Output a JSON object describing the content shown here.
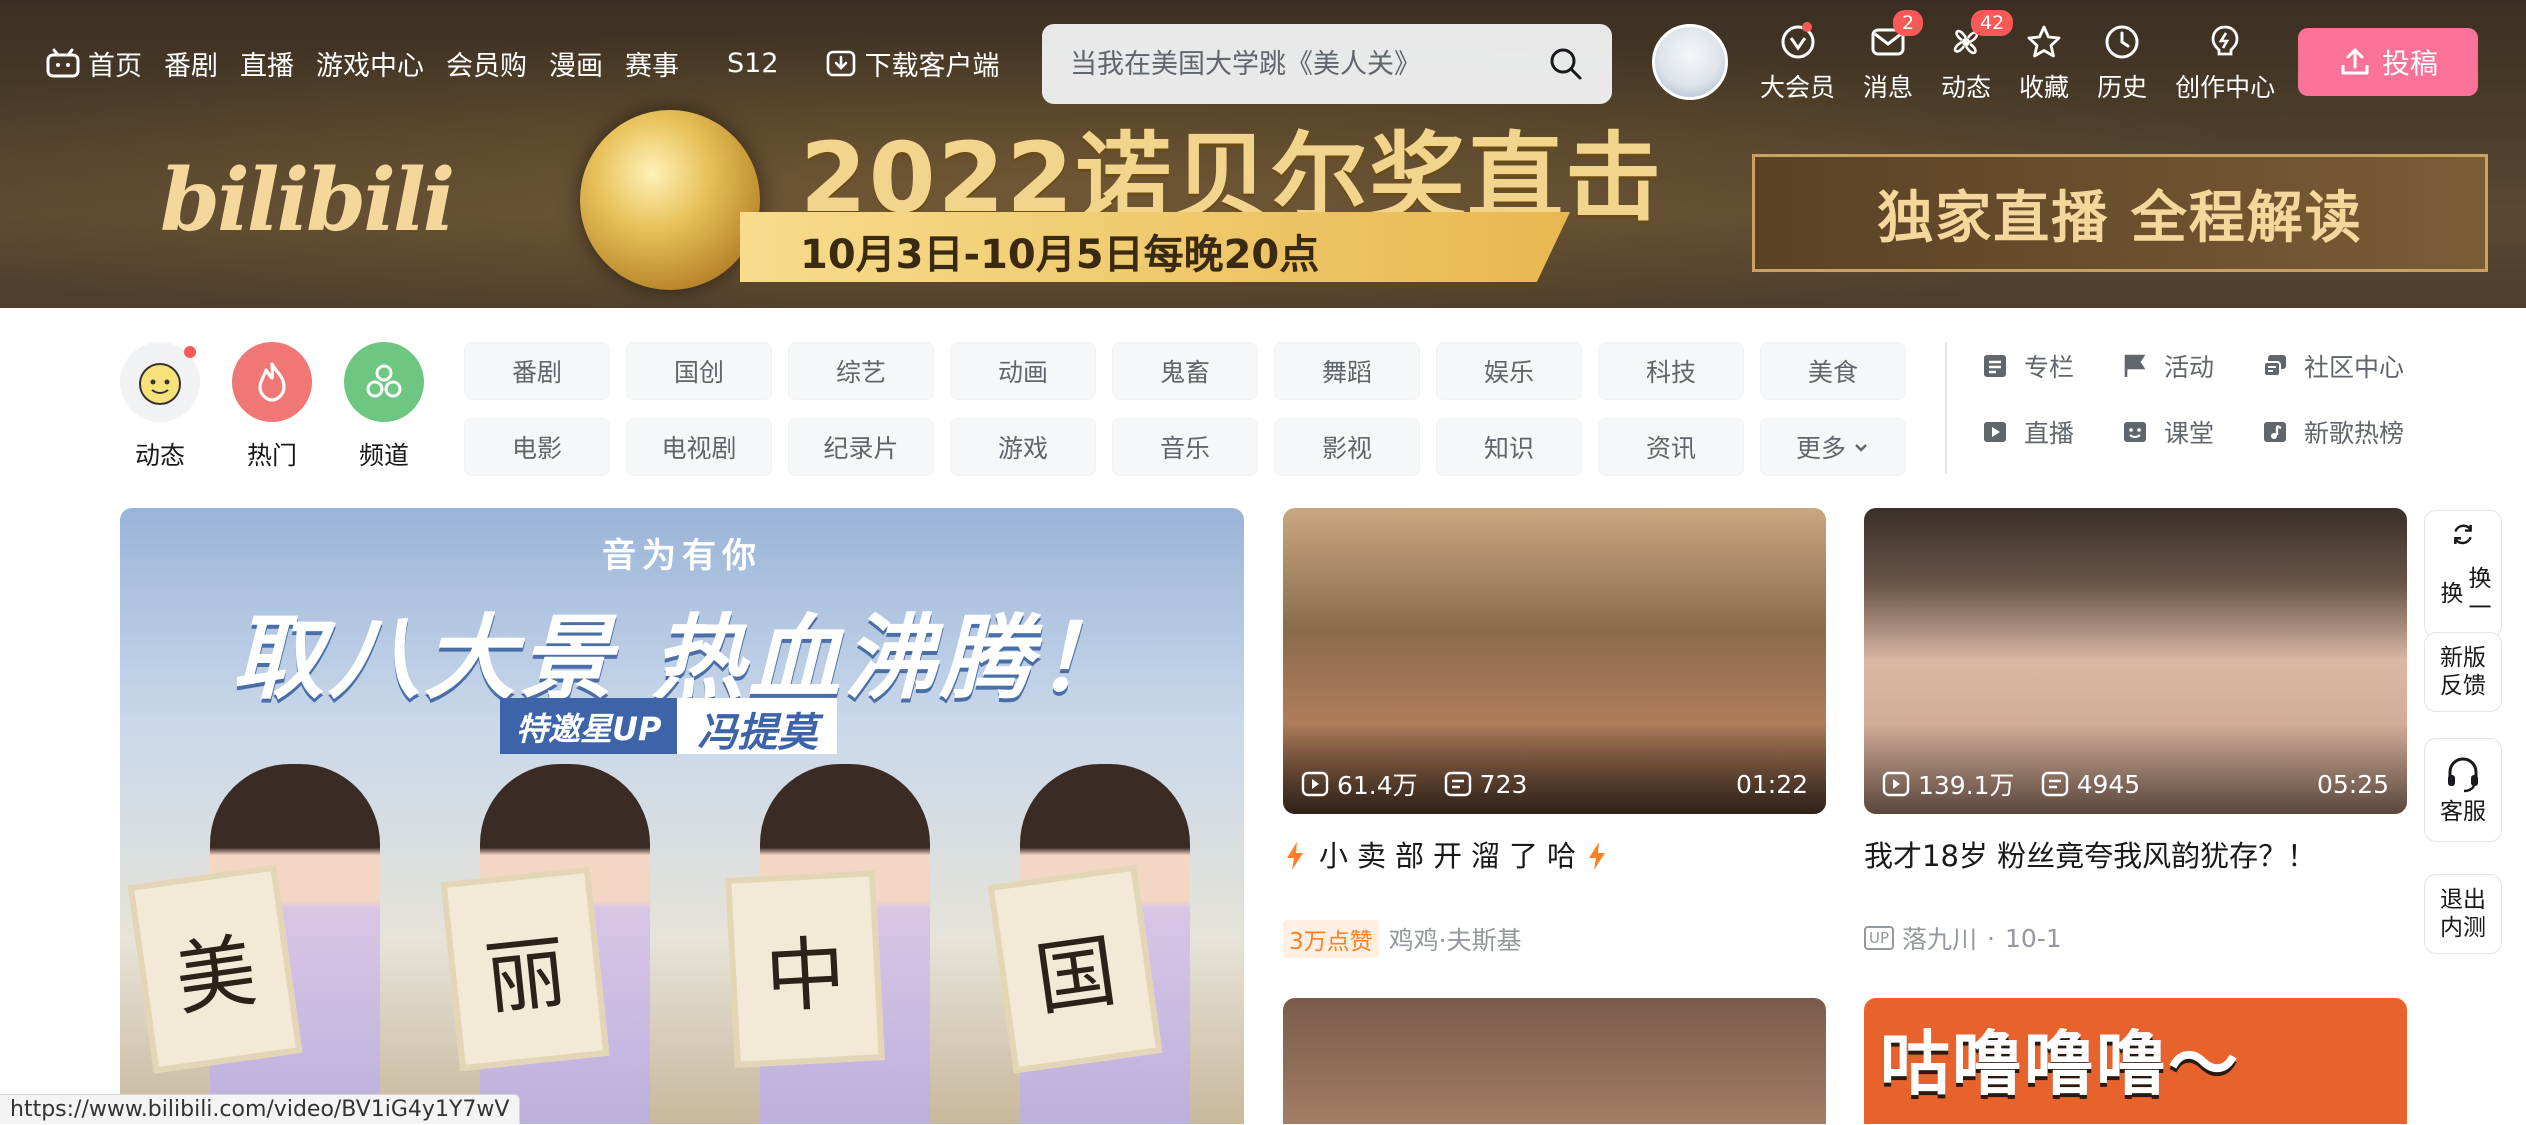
{
  "header": {
    "nav": [
      "首页",
      "番剧",
      "直播",
      "游戏中心",
      "会员购",
      "漫画",
      "赛事"
    ],
    "s12": "S12",
    "download": "下载客户端",
    "search_placeholder": "当我在美国大学跳《美人关》",
    "icons": [
      {
        "label": "大会员",
        "icon": "vip-icon",
        "badge": ""
      },
      {
        "label": "消息",
        "icon": "message-icon",
        "badge": "2"
      },
      {
        "label": "动态",
        "icon": "dynamic-icon",
        "badge": "42"
      },
      {
        "label": "收藏",
        "icon": "star-icon",
        "badge": ""
      },
      {
        "label": "历史",
        "icon": "clock-icon",
        "badge": ""
      },
      {
        "label": "创作中心",
        "icon": "bulb-icon",
        "badge": ""
      }
    ],
    "upload": "投稿"
  },
  "banner": {
    "logo": "bilibili",
    "headline": "2022诺贝尔奖直击",
    "dates": "10月3日-10月5日每晚20点",
    "live": "独家直播 全程解读"
  },
  "quick": [
    {
      "label": "动态",
      "color": "#f1f2f3"
    },
    {
      "label": "热门",
      "color": "#f07775"
    },
    {
      "label": "频道",
      "color": "#6dc781"
    }
  ],
  "channels": [
    "番剧",
    "国创",
    "综艺",
    "动画",
    "鬼畜",
    "舞蹈",
    "娱乐",
    "科技",
    "美食",
    "电影",
    "电视剧",
    "纪录片",
    "游戏",
    "音乐",
    "影视",
    "知识",
    "资讯",
    "更多"
  ],
  "tools": [
    {
      "label": "专栏",
      "icon": "article-icon"
    },
    {
      "label": "活动",
      "icon": "flag-icon"
    },
    {
      "label": "社区中心",
      "icon": "community-icon"
    },
    {
      "label": "直播",
      "icon": "live-icon"
    },
    {
      "label": "课堂",
      "icon": "course-icon"
    },
    {
      "label": "新歌热榜",
      "icon": "music-icon"
    }
  ],
  "carousel": {
    "subtitle": "音为有你",
    "title": "取八大景 热血沸腾！",
    "tag1": "特邀星UP",
    "tag2": "冯提莫",
    "scrolls": [
      "美",
      "丽",
      "中",
      "国"
    ]
  },
  "videos": [
    {
      "views": "61.4万",
      "danmaku": "723",
      "duration": "01:22",
      "title": "小卖部开溜了哈",
      "likes": "3万点赞",
      "author": "鸡鸡·夫斯基",
      "date": ""
    },
    {
      "views": "139.1万",
      "danmaku": "4945",
      "duration": "05:25",
      "title": "我才18岁 粉丝竟夸我风韵犹存？！",
      "likes": "",
      "author": "落九川",
      "date": "10-1"
    }
  ],
  "next_row": {
    "text": "咕噜噜噜～"
  },
  "fab": {
    "refresh": "换一换",
    "feedback": "新版反馈",
    "service": "客服",
    "exit": "退出内测"
  },
  "status_url": "https://www.bilibili.com/video/BV1iG4y1Y7wV",
  "colors": {
    "pink": "#fb7299",
    "red_dot": "#fa5a57",
    "orange": "#ff7f24"
  }
}
